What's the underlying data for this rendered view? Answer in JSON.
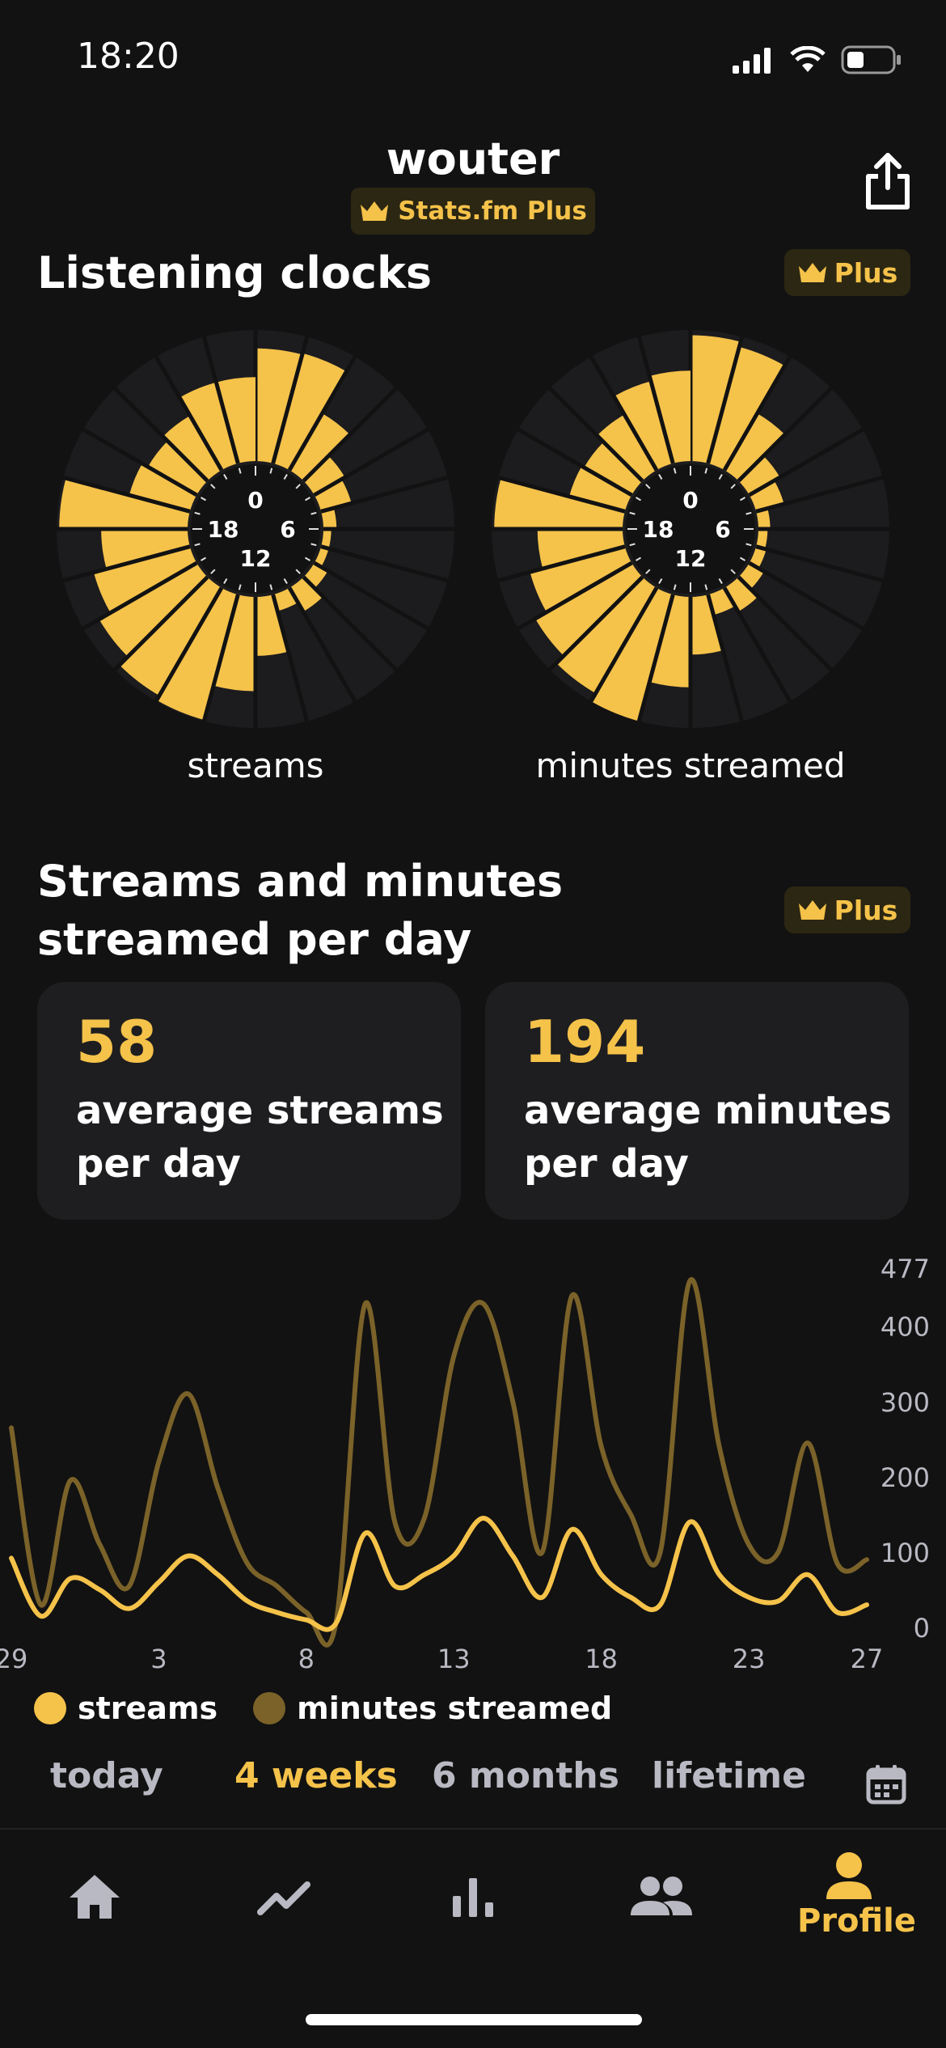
{
  "status_bar": {
    "time": "18:20"
  },
  "header": {
    "username": "wouter",
    "plan_badge": "Stats.fm Plus"
  },
  "listening_clocks": {
    "title": "Listening clocks",
    "plus_label": "Plus",
    "hour_labels": [
      "0",
      "6",
      "12",
      "18"
    ],
    "clocks": [
      {
        "label": "streams",
        "values": [
          0.86,
          0.87,
          0.5,
          0.27,
          0.24,
          0.1,
          0.06,
          0.06,
          0.12,
          0.21,
          0.13,
          0.45,
          0.72,
          0.99,
          0.95,
          0.86,
          0.76,
          0.66,
          0.98,
          0.48,
          0.43,
          0.48,
          0.64,
          0.64
        ]
      },
      {
        "label": "minutes streamed",
        "values": [
          0.96,
          0.92,
          0.5,
          0.27,
          0.22,
          0.09,
          0.07,
          0.08,
          0.13,
          0.21,
          0.16,
          0.44,
          0.69,
          1.0,
          0.93,
          0.85,
          0.75,
          0.65,
          0.98,
          0.44,
          0.42,
          0.49,
          0.65,
          0.69
        ]
      }
    ]
  },
  "per_day": {
    "title": "Streams and minutes streamed per day",
    "plus_label": "Plus",
    "cards": [
      {
        "value": "58",
        "label": "average streams\nper day"
      },
      {
        "value": "194",
        "label": "average minutes\nper day"
      }
    ]
  },
  "chart_data": {
    "type": "line",
    "x": [
      "29",
      "30",
      "31",
      "1",
      "2",
      "3",
      "4",
      "5",
      "6",
      "7",
      "8",
      "9",
      "10",
      "11",
      "12",
      "13",
      "14",
      "15",
      "16",
      "17",
      "18",
      "19",
      "20",
      "21",
      "22",
      "23",
      "24",
      "25",
      "26",
      "27"
    ],
    "x_tick_labels": [
      "29",
      "3",
      "8",
      "13",
      "18",
      "23",
      "27"
    ],
    "y_tick_labels": [
      "0",
      "100",
      "200",
      "300",
      "400",
      "477"
    ],
    "ylim": [
      0,
      477
    ],
    "series": [
      {
        "name": "streams",
        "color": "#f5c24a",
        "values": [
          92,
          15,
          65,
          50,
          25,
          60,
          95,
          70,
          35,
          20,
          10,
          5,
          125,
          55,
          70,
          95,
          145,
          95,
          40,
          130,
          70,
          40,
          30,
          140,
          70,
          40,
          35,
          70,
          20,
          30
        ]
      },
      {
        "name": "minutes streamed",
        "color": "#7a6229",
        "values": [
          265,
          30,
          195,
          110,
          55,
          220,
          310,
          185,
          85,
          55,
          20,
          5,
          430,
          140,
          145,
          360,
          430,
          300,
          100,
          440,
          240,
          150,
          100,
          460,
          240,
          110,
          100,
          245,
          85,
          90
        ]
      }
    ]
  },
  "legend": [
    {
      "label": "streams",
      "color": "#f5c24a"
    },
    {
      "label": "minutes streamed",
      "color": "#7a6229"
    }
  ],
  "ranges": [
    {
      "label": "today",
      "active": false
    },
    {
      "label": "4 weeks",
      "active": true
    },
    {
      "label": "6 months",
      "active": false
    },
    {
      "label": "lifetime",
      "active": false
    }
  ],
  "tab_bar": {
    "items": [
      {
        "icon": "home-icon",
        "label": ""
      },
      {
        "icon": "trending-icon",
        "label": ""
      },
      {
        "icon": "bar-chart-icon",
        "label": ""
      },
      {
        "icon": "friends-icon",
        "label": ""
      },
      {
        "icon": "profile-icon",
        "label": "Profile"
      }
    ]
  },
  "colors": {
    "accent": "#f5c24a",
    "accent_dim": "#7a6229",
    "background": "#121212",
    "card": "#1e1e20"
  }
}
